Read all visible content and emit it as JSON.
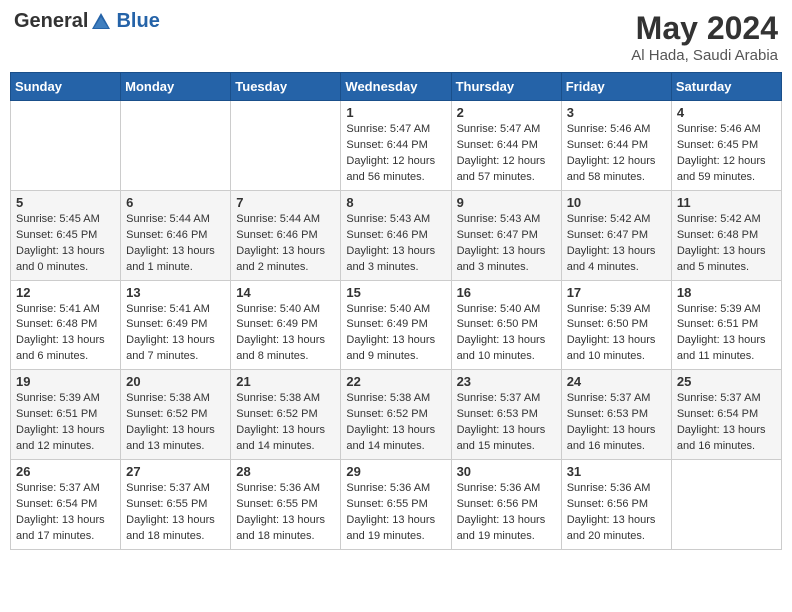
{
  "header": {
    "logo": {
      "general": "General",
      "blue": "Blue"
    },
    "title": "May 2024",
    "subtitle": "Al Hada, Saudi Arabia"
  },
  "weekdays": [
    "Sunday",
    "Monday",
    "Tuesday",
    "Wednesday",
    "Thursday",
    "Friday",
    "Saturday"
  ],
  "weeks": [
    [
      {
        "day": null,
        "info": null
      },
      {
        "day": null,
        "info": null
      },
      {
        "day": null,
        "info": null
      },
      {
        "day": "1",
        "info": "Sunrise: 5:47 AM\nSunset: 6:44 PM\nDaylight: 12 hours\nand 56 minutes."
      },
      {
        "day": "2",
        "info": "Sunrise: 5:47 AM\nSunset: 6:44 PM\nDaylight: 12 hours\nand 57 minutes."
      },
      {
        "day": "3",
        "info": "Sunrise: 5:46 AM\nSunset: 6:44 PM\nDaylight: 12 hours\nand 58 minutes."
      },
      {
        "day": "4",
        "info": "Sunrise: 5:46 AM\nSunset: 6:45 PM\nDaylight: 12 hours\nand 59 minutes."
      }
    ],
    [
      {
        "day": "5",
        "info": "Sunrise: 5:45 AM\nSunset: 6:45 PM\nDaylight: 13 hours\nand 0 minutes."
      },
      {
        "day": "6",
        "info": "Sunrise: 5:44 AM\nSunset: 6:46 PM\nDaylight: 13 hours\nand 1 minute."
      },
      {
        "day": "7",
        "info": "Sunrise: 5:44 AM\nSunset: 6:46 PM\nDaylight: 13 hours\nand 2 minutes."
      },
      {
        "day": "8",
        "info": "Sunrise: 5:43 AM\nSunset: 6:46 PM\nDaylight: 13 hours\nand 3 minutes."
      },
      {
        "day": "9",
        "info": "Sunrise: 5:43 AM\nSunset: 6:47 PM\nDaylight: 13 hours\nand 3 minutes."
      },
      {
        "day": "10",
        "info": "Sunrise: 5:42 AM\nSunset: 6:47 PM\nDaylight: 13 hours\nand 4 minutes."
      },
      {
        "day": "11",
        "info": "Sunrise: 5:42 AM\nSunset: 6:48 PM\nDaylight: 13 hours\nand 5 minutes."
      }
    ],
    [
      {
        "day": "12",
        "info": "Sunrise: 5:41 AM\nSunset: 6:48 PM\nDaylight: 13 hours\nand 6 minutes."
      },
      {
        "day": "13",
        "info": "Sunrise: 5:41 AM\nSunset: 6:49 PM\nDaylight: 13 hours\nand 7 minutes."
      },
      {
        "day": "14",
        "info": "Sunrise: 5:40 AM\nSunset: 6:49 PM\nDaylight: 13 hours\nand 8 minutes."
      },
      {
        "day": "15",
        "info": "Sunrise: 5:40 AM\nSunset: 6:49 PM\nDaylight: 13 hours\nand 9 minutes."
      },
      {
        "day": "16",
        "info": "Sunrise: 5:40 AM\nSunset: 6:50 PM\nDaylight: 13 hours\nand 10 minutes."
      },
      {
        "day": "17",
        "info": "Sunrise: 5:39 AM\nSunset: 6:50 PM\nDaylight: 13 hours\nand 10 minutes."
      },
      {
        "day": "18",
        "info": "Sunrise: 5:39 AM\nSunset: 6:51 PM\nDaylight: 13 hours\nand 11 minutes."
      }
    ],
    [
      {
        "day": "19",
        "info": "Sunrise: 5:39 AM\nSunset: 6:51 PM\nDaylight: 13 hours\nand 12 minutes."
      },
      {
        "day": "20",
        "info": "Sunrise: 5:38 AM\nSunset: 6:52 PM\nDaylight: 13 hours\nand 13 minutes."
      },
      {
        "day": "21",
        "info": "Sunrise: 5:38 AM\nSunset: 6:52 PM\nDaylight: 13 hours\nand 14 minutes."
      },
      {
        "day": "22",
        "info": "Sunrise: 5:38 AM\nSunset: 6:52 PM\nDaylight: 13 hours\nand 14 minutes."
      },
      {
        "day": "23",
        "info": "Sunrise: 5:37 AM\nSunset: 6:53 PM\nDaylight: 13 hours\nand 15 minutes."
      },
      {
        "day": "24",
        "info": "Sunrise: 5:37 AM\nSunset: 6:53 PM\nDaylight: 13 hours\nand 16 minutes."
      },
      {
        "day": "25",
        "info": "Sunrise: 5:37 AM\nSunset: 6:54 PM\nDaylight: 13 hours\nand 16 minutes."
      }
    ],
    [
      {
        "day": "26",
        "info": "Sunrise: 5:37 AM\nSunset: 6:54 PM\nDaylight: 13 hours\nand 17 minutes."
      },
      {
        "day": "27",
        "info": "Sunrise: 5:37 AM\nSunset: 6:55 PM\nDaylight: 13 hours\nand 18 minutes."
      },
      {
        "day": "28",
        "info": "Sunrise: 5:36 AM\nSunset: 6:55 PM\nDaylight: 13 hours\nand 18 minutes."
      },
      {
        "day": "29",
        "info": "Sunrise: 5:36 AM\nSunset: 6:55 PM\nDaylight: 13 hours\nand 19 minutes."
      },
      {
        "day": "30",
        "info": "Sunrise: 5:36 AM\nSunset: 6:56 PM\nDaylight: 13 hours\nand 19 minutes."
      },
      {
        "day": "31",
        "info": "Sunrise: 5:36 AM\nSunset: 6:56 PM\nDaylight: 13 hours\nand 20 minutes."
      },
      {
        "day": null,
        "info": null
      }
    ]
  ]
}
